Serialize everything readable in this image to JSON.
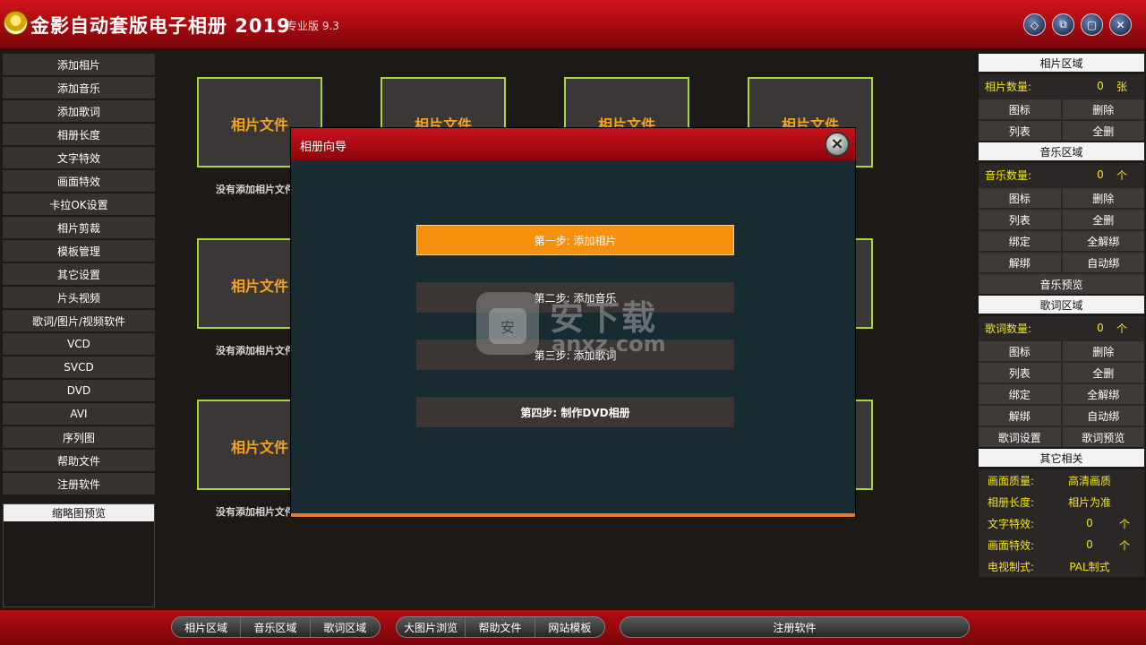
{
  "app": {
    "title": "金影自动套版电子相册 2019",
    "edition": "专业版 9.3"
  },
  "window_buttons": [
    "◇",
    "⧉",
    "▢",
    "✕"
  ],
  "left_menu": [
    "添加相片",
    "添加音乐",
    "添加歌词",
    "相册长度",
    "文字特效",
    "画面特效",
    "卡拉OK设置",
    "相片剪裁",
    "模板管理",
    "其它设置",
    "片头视频",
    "歌词/图片/视频软件",
    "VCD",
    "SVCD",
    "DVD",
    "AVI",
    "序列图",
    "帮助文件",
    "注册软件"
  ],
  "thumbnail_preview": {
    "title": "缩略图预览"
  },
  "grid": {
    "slot_label": "相片文件",
    "caption": "没有添加相片文件"
  },
  "photo_section": {
    "title": "相片区域",
    "count_label": "相片数量:",
    "count_value": "0",
    "count_unit": "张",
    "buttons": [
      [
        "图标",
        "删除"
      ],
      [
        "列表",
        "全删"
      ]
    ]
  },
  "music_section": {
    "title": "音乐区域",
    "count_label": "音乐数量:",
    "count_value": "0",
    "count_unit": "个",
    "buttons": [
      [
        "图标",
        "删除"
      ],
      [
        "列表",
        "全删"
      ],
      [
        "绑定",
        "全解绑"
      ],
      [
        "解绑",
        "自动绑"
      ]
    ],
    "preview": "音乐预览"
  },
  "lyrics_section": {
    "title": "歌词区域",
    "count_label": "歌词数量:",
    "count_value": "0",
    "count_unit": "个",
    "buttons": [
      [
        "图标",
        "删除"
      ],
      [
        "列表",
        "全删"
      ],
      [
        "绑定",
        "全解绑"
      ],
      [
        "解绑",
        "自动绑"
      ],
      [
        "歌词设置",
        "歌词预览"
      ]
    ]
  },
  "other_section": {
    "title": "其它相关",
    "rows": [
      {
        "label": "画面质量:",
        "value": "高清画质",
        "unit": ""
      },
      {
        "label": "相册长度:",
        "value": "相片为准",
        "unit": ""
      },
      {
        "label": "文字特效:",
        "value": "0",
        "unit": "个"
      },
      {
        "label": "画面特效:",
        "value": "0",
        "unit": "个"
      },
      {
        "label": "电视制式:",
        "value": "PAL制式",
        "unit": ""
      }
    ]
  },
  "bottom_bar": {
    "group1": [
      "相片区域",
      "音乐区域",
      "歌词区域"
    ],
    "group2": [
      "大图片浏览",
      "帮助文件",
      "网站模板"
    ],
    "register": "注册软件"
  },
  "dialog": {
    "title": "相册向导",
    "steps": [
      "第一步: 添加相片",
      "第二步: 添加音乐",
      "第三步: 添加歌词",
      "第四步: 制作DVD相册"
    ]
  },
  "watermark": {
    "text": "安下载",
    "sub": "anxz.com",
    "badge": "安"
  },
  "colors": {
    "titlebar_red": "#c0101a",
    "accent_orange": "#f4900e",
    "slot_border": "#a8d63c",
    "label_orange": "#f5a21e",
    "count_yellow": "#f2e41a"
  }
}
